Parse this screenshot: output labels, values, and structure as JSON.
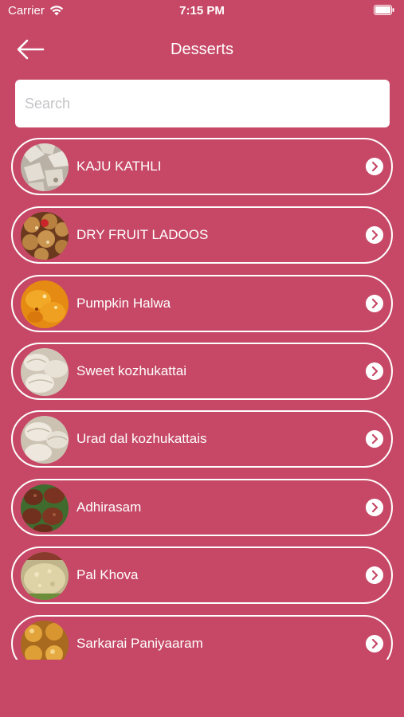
{
  "status_bar": {
    "carrier": "Carrier",
    "time": "7:15 PM"
  },
  "header": {
    "title": "Desserts",
    "back_icon": "arrow-left-icon"
  },
  "search": {
    "placeholder": "Search",
    "value": ""
  },
  "colors": {
    "background": "#c64866",
    "text": "#ffffff"
  },
  "items": [
    {
      "label": "KAJU KATHLI"
    },
    {
      "label": "DRY FRUIT LADOOS"
    },
    {
      "label": "Pumpkin Halwa"
    },
    {
      "label": "Sweet kozhukattai"
    },
    {
      "label": "Urad dal kozhukattais"
    },
    {
      "label": "Adhirasam"
    },
    {
      "label": "Pal Khova"
    },
    {
      "label": "Sarkarai Paniyaaram"
    }
  ]
}
